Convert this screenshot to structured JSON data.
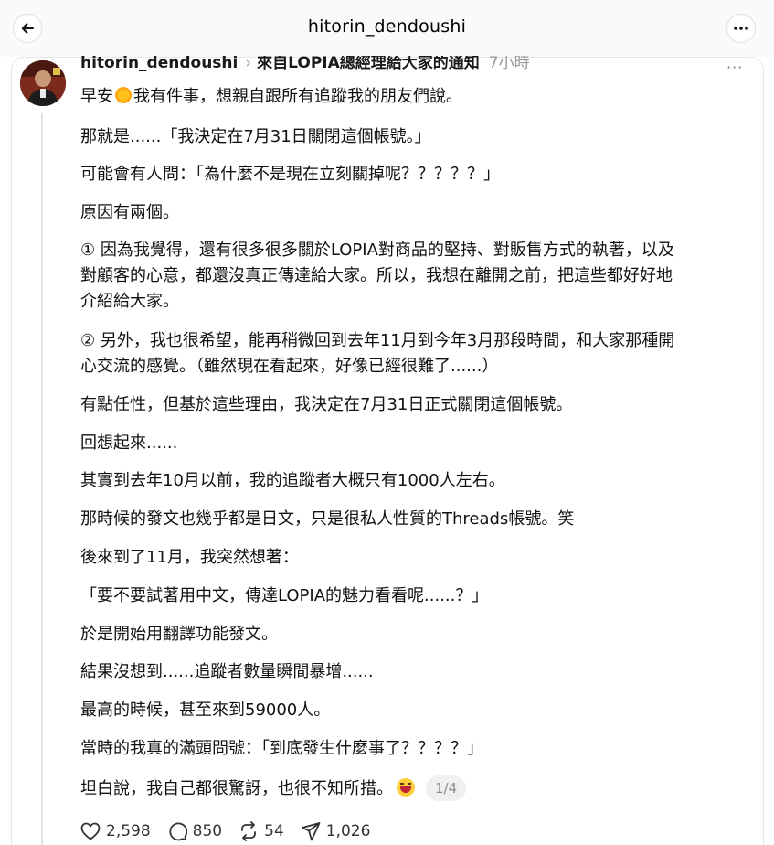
{
  "topbar": {
    "title": "hitorin_dendoushi",
    "back_icon": "arrow-left-icon",
    "more_icon": "ellipsis-icon"
  },
  "post": {
    "username": "hitorin_dendoushi",
    "chevron": "›",
    "topic": "來自LOPIA總經理給大家的通知",
    "time": "7小時",
    "more": "···",
    "lines": [
      {
        "before": "早安",
        "after": "我有件事，想親自跟所有追蹤我的朋友們說。"
      },
      "那就是......「我決定在7月31日關閉這個帳號。」",
      "可能會有人問：「為什麼不是現在立刻關掉呢？？？？？」",
      "原因有兩個。",
      "① 因為我覺得，還有很多很多關於LOPIA對商品的堅持、對販售方式的執著，以及",
      "對顧客的心意，都還沒真正傳達給大家。所以，我想在離開之前，把這些都好好地",
      "介紹給大家。",
      "② 另外，我也很希望，能再稍微回到去年11月到今年3月那段時間，和大家那種開",
      "心交流的感覺。（雖然現在看起來，好像已經很難了......）",
      "有點任性，但基於這些理由，我決定在7月31日正式關閉這個帳號。",
      "回想起來......",
      "其實到去年10月以前，我的追蹤者大概只有1000人左右。",
      "那時候的發文也幾乎都是日文，只是很私人性質的Threads帳號。笑",
      "後來到了11月，我突然想著：",
      "「要不要試著用中文，傳達LOPIA的魅力看看呢......？」",
      "於是開始用翻譯功能發文。",
      "結果沒想到......追蹤者數量瞬間暴增......",
      "最高的時候，甚至來到59000人。",
      "當時的我真的滿頭問號：「到底發生什麼事了？？？？」",
      "坦白說，我自己都很驚訝，也很不知所措。"
    ],
    "page_indicator": "1/4",
    "emoji_icons": [
      "sun-emoji-icon",
      "laughing-emoji-icon"
    ]
  },
  "actions": {
    "likes": "2,598",
    "comments": "850",
    "reposts": "54",
    "shares": "1,026"
  },
  "colors": {
    "background": "#ffffff",
    "topbar_bg": "#fafafa",
    "muted_text": "#999999",
    "badge_bg": "#f0f0f0"
  }
}
